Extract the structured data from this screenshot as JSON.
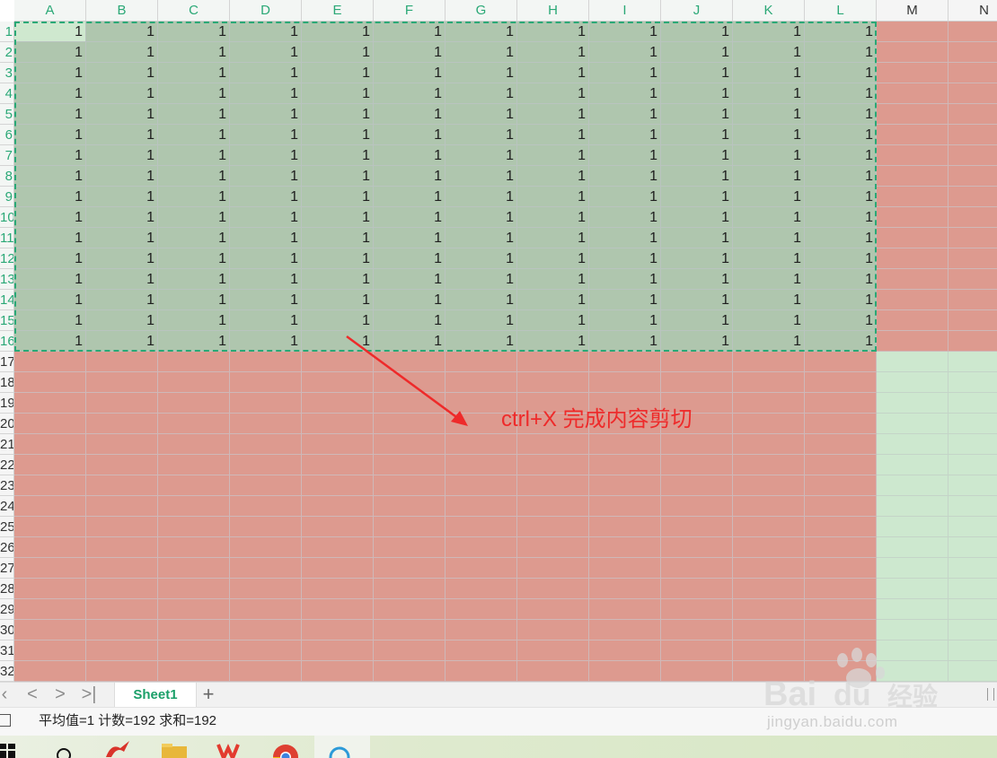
{
  "spreadsheet": {
    "columns": [
      "A",
      "B",
      "C",
      "D",
      "E",
      "F",
      "G",
      "H",
      "I",
      "J",
      "K",
      "L",
      "M",
      "N"
    ],
    "selected_columns": 12,
    "rows": [
      "1",
      "2",
      "3",
      "4",
      "5",
      "6",
      "7",
      "8",
      "9",
      "10",
      "11",
      "12",
      "13",
      "14",
      "15",
      "16",
      "17",
      "18",
      "19",
      "20",
      "21",
      "22",
      "23",
      "24",
      "25",
      "26",
      "27",
      "28",
      "29",
      "30",
      "31",
      "32"
    ],
    "selected_rows": 16,
    "cell_value": "1",
    "cut_range": "A1:L16",
    "colors": {
      "selection": "#afc6ae",
      "active_cell": "#cfe8cf",
      "fill_red": "#dd9a8f",
      "fill_light_green": "#cde8cf",
      "cut_border": "#2aa876",
      "accent": "#1a9f68"
    }
  },
  "annotation": {
    "text": "ctrl+X 完成内容剪切",
    "color": "#ee2a2a"
  },
  "sheet_bar": {
    "nav_first": "|<",
    "nav_prev": "<",
    "nav_next": ">",
    "nav_last": ">|",
    "active_sheet": "Sheet1",
    "add_sheet": "+"
  },
  "status_bar": {
    "text": "平均值=1  计数=192  求和=192"
  },
  "taskbar": {
    "icons": [
      "windows-start-icon",
      "search-icon",
      "app-icon",
      "file-explorer-icon",
      "wps-office-icon",
      "chrome-icon",
      "browser-icon"
    ]
  },
  "watermark": {
    "brand_text": "Bai du 经验",
    "url": "jingyan.baidu.com"
  }
}
